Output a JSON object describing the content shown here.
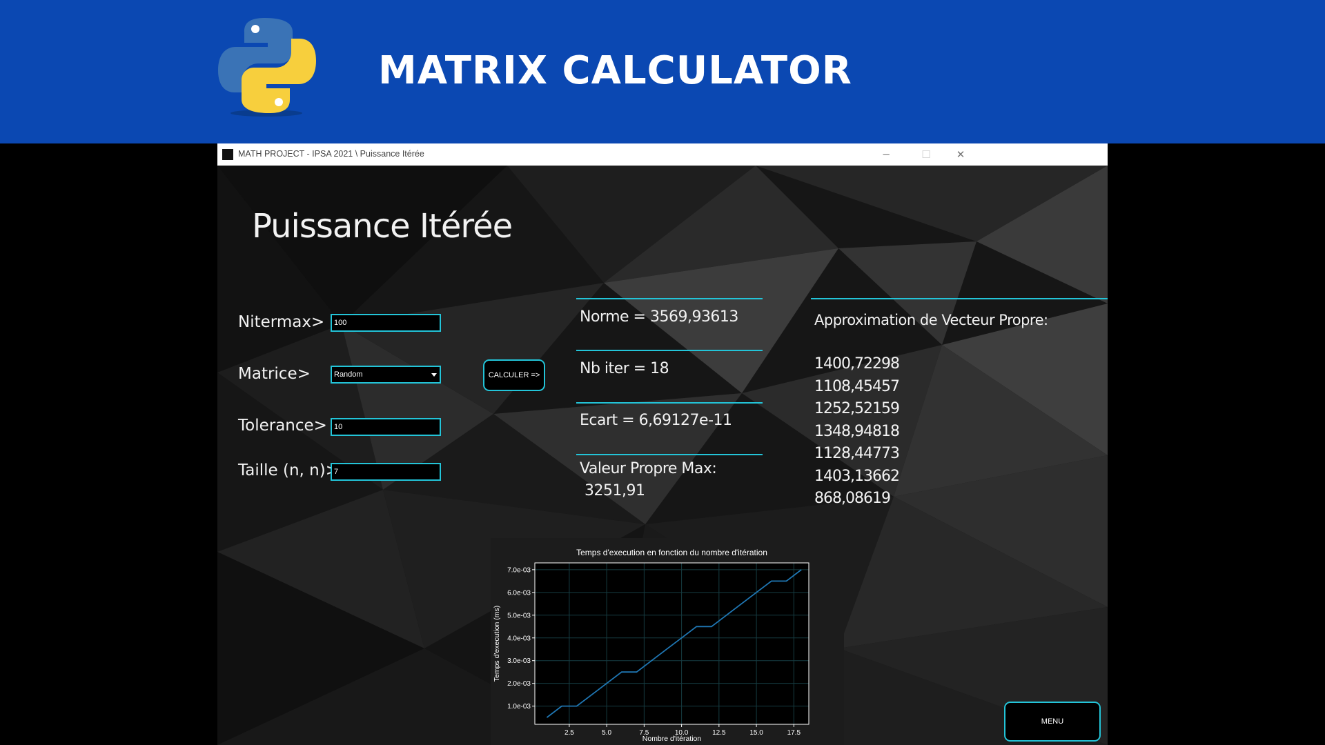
{
  "banner": {
    "title": "MATRIX CALCULATOR"
  },
  "window": {
    "title": "MATH PROJECT - IPSA 2021 \\ Puissance Itérée",
    "controls": {
      "minimize": "─",
      "maximize": "☐",
      "close": "✕"
    }
  },
  "page": {
    "title": "Puissance Itérée"
  },
  "form": {
    "nitermax": {
      "label": "Nitermax>",
      "value": "100"
    },
    "matrice": {
      "label": "Matrice>",
      "value": "Random"
    },
    "tolerance": {
      "label": "Tolerance>",
      "value": "10"
    },
    "taille": {
      "label": "Taille (n, n)>",
      "value": "7"
    },
    "calc_button": "CALCULER =>"
  },
  "results": {
    "norme": "Norme = 3569,93613",
    "nb_iter": "Nb iter = 18",
    "ecart": "Ecart = 6,69127e-11",
    "valeur_propre_label": "Valeur Propre Max:",
    "valeur_propre_value": "3251,91"
  },
  "vector": {
    "heading": "Approximation de Vecteur Propre:",
    "values": [
      "1400,72298",
      "1108,45457",
      "1252,52159",
      "1348,94818",
      "1128,44773",
      "1403,13662",
      "868,08619"
    ]
  },
  "menu_button": "MENU",
  "colors": {
    "accent": "#23c4d8",
    "banner": "#0b48b2",
    "line": "#1f77b4"
  },
  "chart_data": {
    "type": "line",
    "title": "Temps d'execution en fonction du nombre d'itération",
    "xlabel": "Nombre d'itération",
    "ylabel": "Temps d'execution (ms)",
    "xlim": [
      0.2,
      18.5
    ],
    "ylim": [
      0.0002,
      0.0073
    ],
    "xticks": [
      "2.5",
      "5.0",
      "7.5",
      "10.0",
      "12.5",
      "15.0",
      "17.5"
    ],
    "xtick_values": [
      2.5,
      5.0,
      7.5,
      10.0,
      12.5,
      15.0,
      17.5
    ],
    "yticks": [
      "1.0e-03",
      "2.0e-03",
      "3.0e-03",
      "4.0e-03",
      "5.0e-03",
      "6.0e-03",
      "7.0e-03"
    ],
    "ytick_values": [
      0.001,
      0.002,
      0.003,
      0.004,
      0.005,
      0.006,
      0.007
    ],
    "grid": true,
    "x": [
      1,
      2,
      3,
      4,
      5,
      6,
      7,
      8,
      9,
      10,
      11,
      12,
      13,
      14,
      15,
      16,
      17,
      18
    ],
    "y": [
      0.0005,
      0.001,
      0.001,
      0.0015,
      0.002,
      0.0025,
      0.0025,
      0.003,
      0.0035,
      0.004,
      0.0045,
      0.0045,
      0.005,
      0.0055,
      0.006,
      0.0065,
      0.0065,
      0.007
    ]
  }
}
